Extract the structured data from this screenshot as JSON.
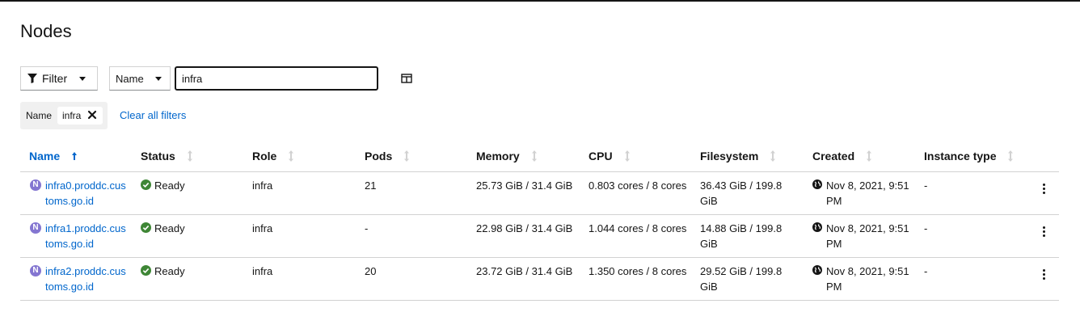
{
  "page_title": "Nodes",
  "toolbar": {
    "filter_label": "Filter",
    "attribute_label": "Name",
    "search_value": "infra"
  },
  "chips": {
    "category": "Name",
    "value": "infra",
    "clear_all": "Clear all filters"
  },
  "table": {
    "columns": [
      "Name",
      "Status",
      "Role",
      "Pods",
      "Memory",
      "CPU",
      "Filesystem",
      "Created",
      "Instance type"
    ],
    "rows": [
      {
        "badge": "N",
        "name": "infra0.proddc.customs.go.id",
        "status": "Ready",
        "role": "infra",
        "pods": "21",
        "memory": "25.73 GiB / 31.4 GiB",
        "cpu": "0.803 cores / 8 cores",
        "filesystem": "36.43 GiB / 199.8 GiB",
        "created": "Nov 8, 2021, 9:51 PM",
        "instance_type": "-"
      },
      {
        "badge": "N",
        "name": "infra1.proddc.customs.go.id",
        "status": "Ready",
        "role": "infra",
        "pods": "-",
        "memory": "22.98 GiB / 31.4 GiB",
        "cpu": "1.044 cores / 8 cores",
        "filesystem": "14.88 GiB / 199.8 GiB",
        "created": "Nov 8, 2021, 9:51 PM",
        "instance_type": "-"
      },
      {
        "badge": "N",
        "name": "infra2.proddc.customs.go.id",
        "status": "Ready",
        "role": "infra",
        "pods": "20",
        "memory": "23.72 GiB / 31.4 GiB",
        "cpu": "1.350 cores / 8 cores",
        "filesystem": "29.52 GiB / 199.8 GiB",
        "created": "Nov 8, 2021, 9:51 PM",
        "instance_type": "-"
      }
    ]
  },
  "colors": {
    "link": "#0066cc",
    "ready": "#3e8635",
    "node_badge": "#8476d1"
  }
}
